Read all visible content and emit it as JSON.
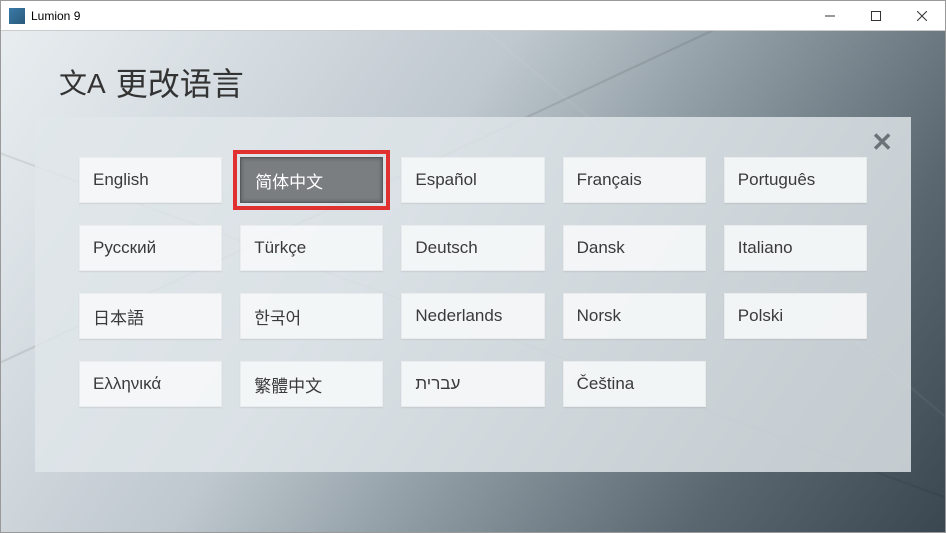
{
  "window": {
    "title": "Lumion 9"
  },
  "header": {
    "icon_label": "文A",
    "title": "更改语言"
  },
  "close_label": "✕",
  "languages": [
    {
      "name": "english",
      "label": "English",
      "selected": false,
      "highlighted": false
    },
    {
      "name": "simplified-chinese",
      "label": "简体中文",
      "selected": true,
      "highlighted": true
    },
    {
      "name": "spanish",
      "label": "Español",
      "selected": false,
      "highlighted": false
    },
    {
      "name": "french",
      "label": "Français",
      "selected": false,
      "highlighted": false
    },
    {
      "name": "portuguese",
      "label": "Português",
      "selected": false,
      "highlighted": false
    },
    {
      "name": "russian",
      "label": "Русский",
      "selected": false,
      "highlighted": false
    },
    {
      "name": "turkish",
      "label": "Türkçe",
      "selected": false,
      "highlighted": false
    },
    {
      "name": "german",
      "label": "Deutsch",
      "selected": false,
      "highlighted": false
    },
    {
      "name": "danish",
      "label": "Dansk",
      "selected": false,
      "highlighted": false
    },
    {
      "name": "italian",
      "label": "Italiano",
      "selected": false,
      "highlighted": false
    },
    {
      "name": "japanese",
      "label": "日本語",
      "selected": false,
      "highlighted": false
    },
    {
      "name": "korean",
      "label": "한국어",
      "selected": false,
      "highlighted": false
    },
    {
      "name": "dutch",
      "label": "Nederlands",
      "selected": false,
      "highlighted": false
    },
    {
      "name": "norwegian",
      "label": "Norsk",
      "selected": false,
      "highlighted": false
    },
    {
      "name": "polish",
      "label": "Polski",
      "selected": false,
      "highlighted": false
    },
    {
      "name": "greek",
      "label": "Ελληνικά",
      "selected": false,
      "highlighted": false
    },
    {
      "name": "traditional-chinese",
      "label": "繁體中文",
      "selected": false,
      "highlighted": false
    },
    {
      "name": "hebrew",
      "label": "עברית",
      "selected": false,
      "highlighted": false
    },
    {
      "name": "czech",
      "label": "Čeština",
      "selected": false,
      "highlighted": false
    }
  ]
}
